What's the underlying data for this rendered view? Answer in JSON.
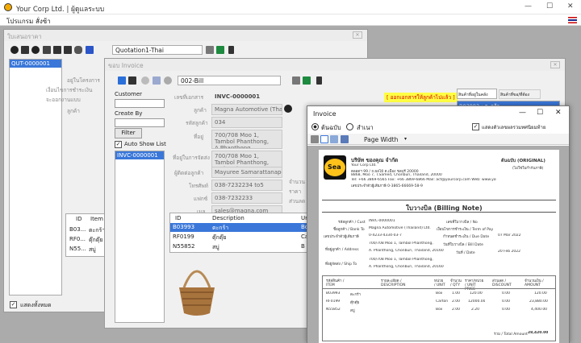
{
  "app": {
    "title": "Your Corp Ltd. | ผู้ดูแลระบบ"
  },
  "menu": {
    "items": [
      "โปรแกรม",
      "สั่งซ้า"
    ]
  },
  "quotation_window": {
    "title": "ใบเสนอราคา",
    "doc_type": "Quotation1-Thai",
    "list_item": "QUT-0000001",
    "labels": [
      "อยู่ในโครงการ",
      "เงื่อนไขการชำระเงิน",
      "จะออกงานแบบ",
      "ลูกค้า"
    ],
    "show_all_label": "แสดงทั้งหมด",
    "grid_headers": [
      "ID",
      "Item"
    ],
    "grid_rows": [
      {
        "id": "B03...",
        "item": "ตะกร้า"
      },
      {
        "id": "RF0...",
        "item": "ตุ๊กตุ๊ย"
      },
      {
        "id": "N55...",
        "item": "สบู่"
      }
    ]
  },
  "invoice_window": {
    "title": "ขอบ Invoice",
    "doc_type": "002-Bill",
    "customer_label": "Customer",
    "created_by_label": "Create By",
    "filter_label": "Filter",
    "auto_show_label": "Auto Show List",
    "list_item": "INVC-0000001",
    "warning_text": "[ ออกเอกสารให้ลูกค้าไปแล้ว ]",
    "fields": [
      {
        "label": "เลขที่เอกสาร",
        "value": "INVC-0000001"
      },
      {
        "label": "ลูกค้า",
        "value": "Magna Automotive (Thailand) L"
      },
      {
        "label": "รหัสลูกค้า",
        "value": "034"
      },
      {
        "label": "ที่อยู่",
        "value": "700/708 Moo 1, Tambol Phanthong, A.Phanthong,"
      },
      {
        "label": "ที่อยู่ในการจัดส่ง",
        "value": "700/708 Moo 1, Tambol Phanthong, A.Phanthong,"
      },
      {
        "label": "ผู้ติดต่อลูกค้า",
        "value": "Mayuree Samarattanaporn"
      },
      {
        "label": "โทรศัพท์",
        "value": "038-7232234 to5"
      },
      {
        "label": "แฟกซ์",
        "value": "038-7232233"
      },
      {
        "label": "เมล",
        "value": "sales@magna.com"
      }
    ],
    "grid_headers": [
      "ID",
      "Description",
      "Uni"
    ],
    "grid_rows": [
      {
        "id": "B03993",
        "desc": "ตะกร้า",
        "unit": "Bo"
      },
      {
        "id": "RF0199",
        "desc": "ตุ๊กตุ๊ย",
        "unit": "Ca"
      },
      {
        "id": "N55852",
        "desc": "สบู่",
        "unit": "B"
      }
    ],
    "side_tabs": [
      "สินค้าที่อยู่ในคลัง",
      "สินค้าที่ขอ/ที่ต้อง"
    ],
    "side_item": "B03993 : ตะกร้า",
    "side_labels": [
      "จำนวน",
      "ราคา",
      "ส่วนลด"
    ]
  },
  "report_window": {
    "title": "Invoice",
    "radio_original": "ต้นฉบับ",
    "radio_copy": "สำเนา",
    "checkbox_label": "แสดงตัวเลขผลรวมทศนิยมท้าย",
    "page_width": "Page Width",
    "company_name": "บริษัท ของคุณ จำกัด",
    "company_en": "Your Corp Ltd.",
    "original_label": "ต้นฉบับ (ORIGINAL)",
    "original_sub": "(ไม่ใช่ใบกำกับภาษี)",
    "doc_title": "ใบวางบิล (Billing Note)",
    "addr_lines": [
      "ตลอดฯ 99 / ถ.ผลไม้ ต.เมือง ชลบุรี 20000",
      "8868, Moo 7, T.Samed, Chonburi, Thailand, 20000",
      "Tel: +66 3869-6565  Fax: +66 3869-6866  Mail: act@yourcorp.com  Web: www.yourcorp.com",
      "เลขประจำตัวผู้เสียภาษี 0-3865-66669-58-9"
    ],
    "left_info": [
      {
        "k": "รหัสลูกค้า / Cust",
        "v": "INVC-0000001"
      },
      {
        "k": "ชื่อลูกค้า / Bank To",
        "v": "Magna Automotive (Thailand) Ltd."
      },
      {
        "k": "เลขประจำตัวผู้เสียภาษี",
        "v": "0-4233-4334-03-7"
      },
      {
        "k": "ที่อยู่ลูกค้า / Address",
        "v": "700/708 Moo 1, Tambol Phanthong,"
      },
      {
        "k": "",
        "v": "A. Phanthong, Chonburi, Thailand, 20160"
      },
      {
        "k": "ที่อยู่จัดส่ง / Ship To",
        "v": "700/708 Moo 1, Tambol Phanthong,"
      },
      {
        "k": "",
        "v": "A. Phanthong, Chonburi, Thailand, 20160"
      }
    ],
    "right_info": [
      {
        "k": "เลขที่ใบวางบิล / No",
        "v": ""
      },
      {
        "k": "เงื่อนไขการชำระเงิน / Term of Pay",
        "v": ""
      },
      {
        "k": "กำหนดชำระเงิน / Due Date",
        "v": "07 Mar 2022"
      },
      {
        "k": "วันที่ใบวางบิล / Bill Date",
        "v": ""
      },
      {
        "k": "วันที่ / Date",
        "v": "20 Feb 2022"
      }
    ],
    "table_headers": [
      "รหัสสินค้า / ITEM",
      "รายละเอียด / DESCRIPTION",
      "หน่วย / UNIT",
      "จำนวน / QTY",
      "ราคา/หน่วย / UNIT PRICE",
      "ส่วนลด / DISCOUNT",
      "จำนวนเงิน / AMOUNT"
    ],
    "table_rows": [
      [
        "B03993",
        "ตะกร้า",
        "Box",
        "1.00",
        "120.00",
        "0.00",
        "120.00"
      ],
      [
        "RF0199",
        "ตุ๊กตุ๊ย",
        "Carton",
        "2.00",
        "12000.00",
        "0.00",
        "23,880.00"
      ],
      [
        "N55852",
        "สบู่",
        "Box",
        "2.00",
        "2.20",
        "0.00",
        "4,400.00"
      ]
    ],
    "total_label": "รวม / Total Amount",
    "total_value": "28,420.00"
  }
}
